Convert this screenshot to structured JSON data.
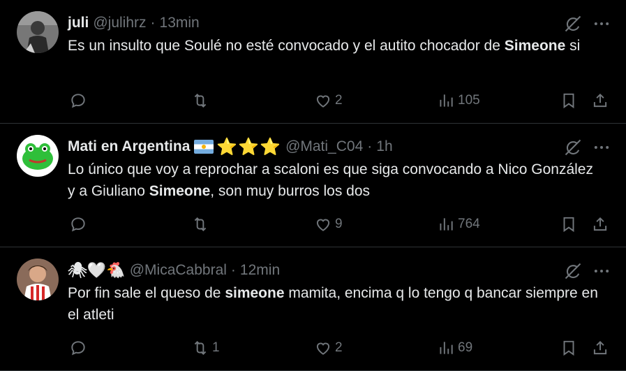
{
  "tweets": [
    {
      "name": "juli",
      "handle": "@julihrz",
      "separator": "·",
      "time": "13min",
      "text_parts": [
        "Es un insulto que Soulé no esté convocado y el autito chocador de ",
        "Simeone",
        " si"
      ],
      "replies": "",
      "retweets": "",
      "likes": "2",
      "views": "105"
    },
    {
      "name": "Mati en Argentina",
      "name_decor": "⭐⭐⭐",
      "handle": "@Mati_C04",
      "separator": "·",
      "time": "1h",
      "text_parts": [
        "Lo único que voy a reprochar a scaloni es que siga convocando a Nico González y a Giuliano ",
        "Simeone",
        ", son muy burros los dos"
      ],
      "replies": "",
      "retweets": "",
      "likes": "9",
      "views": "764"
    },
    {
      "name": "🕷🤍🐔",
      "handle": "@MicaCabbral",
      "separator": "·",
      "time": "12min",
      "text_parts": [
        "Por fin sale el queso de ",
        "simeone",
        " mamita, encima q lo tengo q bancar siempre en el atleti"
      ],
      "replies": "",
      "retweets": "1",
      "likes": "2",
      "views": "69"
    }
  ],
  "icons": [
    "reply-icon",
    "retweet-icon",
    "like-icon",
    "views-icon",
    "bookmark-icon",
    "share-icon",
    "grok-icon",
    "more-icon"
  ],
  "colors": {
    "background": "#000000",
    "text": "#e7e9ea",
    "muted": "#71767b",
    "divider": "#2f3336"
  }
}
